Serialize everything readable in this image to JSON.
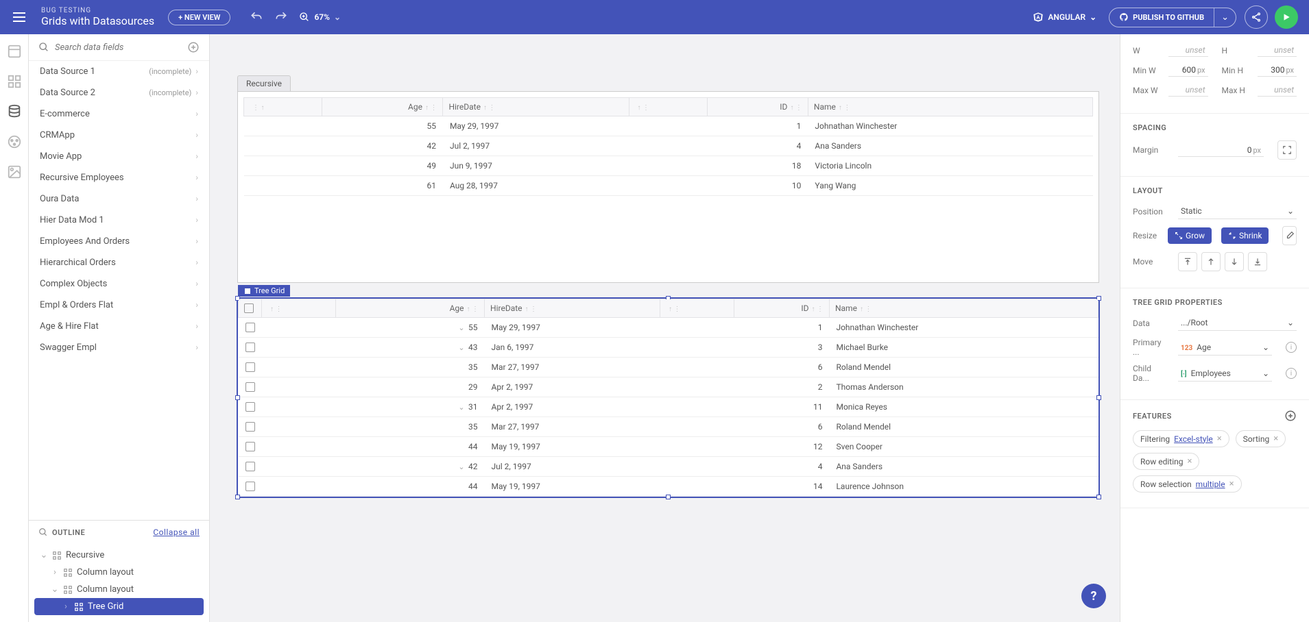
{
  "header": {
    "subtitle": "BUG TESTING",
    "title": "Grids with Datasources",
    "new_view": "+ NEW VIEW",
    "zoom": "67%",
    "framework": "ANGULAR",
    "publish": "PUBLISH TO GITHUB"
  },
  "left": {
    "search_placeholder": "Search data fields",
    "datasources": [
      {
        "label": "Data Source 1",
        "meta": "(incomplete)"
      },
      {
        "label": "Data Source 2",
        "meta": "(incomplete)"
      },
      {
        "label": "E-commerce"
      },
      {
        "label": "CRMApp"
      },
      {
        "label": "Movie App"
      },
      {
        "label": "Recursive Employees"
      },
      {
        "label": "Oura Data"
      },
      {
        "label": "Hier Data Mod 1"
      },
      {
        "label": "Employees And Orders"
      },
      {
        "label": "Hierarchical Orders"
      },
      {
        "label": "Complex Objects"
      },
      {
        "label": "Empl & Orders Flat"
      },
      {
        "label": "Age & Hire Flat"
      },
      {
        "label": "Swagger Empl"
      }
    ],
    "outline_label": "OUTLINE",
    "collapse": "Collapse all",
    "outline": [
      {
        "label": "Recursive",
        "depth": 0,
        "exp": "v"
      },
      {
        "label": "Column layout",
        "depth": 1,
        "exp": ">"
      },
      {
        "label": "Column layout",
        "depth": 1,
        "exp": "v"
      },
      {
        "label": "Tree Grid",
        "depth": 2,
        "exp": ">",
        "selected": true
      }
    ]
  },
  "canvas": {
    "tab": "Recursive",
    "grid1": {
      "columns": [
        "",
        "Age",
        "HireDate",
        "",
        "ID",
        "Name"
      ],
      "rows": [
        {
          "age": "55",
          "hire": "May 29, 1997",
          "id": "1",
          "name": "Johnathan Winchester"
        },
        {
          "age": "42",
          "hire": "Jul 2, 1997",
          "id": "4",
          "name": "Ana Sanders"
        },
        {
          "age": "49",
          "hire": "Jun 9, 1997",
          "id": "18",
          "name": "Victoria Lincoln"
        },
        {
          "age": "61",
          "hire": "Aug 28, 1997",
          "id": "10",
          "name": "Yang Wang"
        }
      ]
    },
    "selected_label": "Tree Grid",
    "grid2": {
      "columns": [
        "",
        "",
        "Age",
        "HireDate",
        "",
        "ID",
        "Name"
      ],
      "rows": [
        {
          "ind": 0,
          "exp": "v",
          "age": "55",
          "hire": "May 29, 1997",
          "id": "1",
          "name": "Johnathan Winchester"
        },
        {
          "ind": 1,
          "exp": "v",
          "age": "43",
          "hire": "Jan 6, 1997",
          "id": "3",
          "name": "Michael Burke"
        },
        {
          "ind": 2,
          "exp": "",
          "age": "35",
          "hire": "Mar 27, 1997",
          "id": "6",
          "name": "Roland Mendel"
        },
        {
          "ind": 2,
          "exp": "",
          "age": "29",
          "hire": "Apr 2, 1997",
          "id": "2",
          "name": "Thomas Anderson"
        },
        {
          "ind": 1,
          "exp": "v",
          "age": "31",
          "hire": "Apr 2, 1997",
          "id": "11",
          "name": "Monica Reyes"
        },
        {
          "ind": 2,
          "exp": "",
          "age": "35",
          "hire": "Mar 27, 1997",
          "id": "6",
          "name": "Roland Mendel"
        },
        {
          "ind": 2,
          "exp": "",
          "age": "44",
          "hire": "May 19, 1997",
          "id": "12",
          "name": "Sven Cooper"
        },
        {
          "ind": 0,
          "exp": "v",
          "age": "42",
          "hire": "Jul 2, 1997",
          "id": "4",
          "name": "Ana Sanders"
        },
        {
          "ind": 2,
          "exp": "",
          "age": "44",
          "hire": "May 19, 1997",
          "id": "14",
          "name": "Laurence Johnson"
        }
      ]
    }
  },
  "right": {
    "size": {
      "w": "unset",
      "h": "unset",
      "minw": "600",
      "minh": "300",
      "maxw": "unset",
      "maxh": "unset",
      "unit": "px",
      "labels": {
        "w": "W",
        "h": "H",
        "minw": "Min W",
        "minh": "Min H",
        "maxw": "Max W",
        "maxh": "Max H"
      }
    },
    "spacing": {
      "title": "SPACING",
      "margin_label": "Margin",
      "margin": "0",
      "unit": "px"
    },
    "layout": {
      "title": "LAYOUT",
      "position_label": "Position",
      "position": "Static",
      "resize_label": "Resize",
      "grow": "Grow",
      "shrink": "Shrink",
      "move_label": "Move"
    },
    "treegrid": {
      "title": "TREE GRID PROPERTIES",
      "data_label": "Data",
      "data_value": ".../Root",
      "primary_label": "Primary ...",
      "primary_type": "123",
      "primary_value": "Age",
      "child_label": "Child Da...",
      "child_value": "Employees"
    },
    "features": {
      "title": "FEATURES",
      "filtering": "Filtering",
      "filtering_link": "Excel-style",
      "sorting": "Sorting",
      "row_editing": "Row editing",
      "row_selection": "Row selection",
      "row_selection_link": "multiple"
    }
  }
}
